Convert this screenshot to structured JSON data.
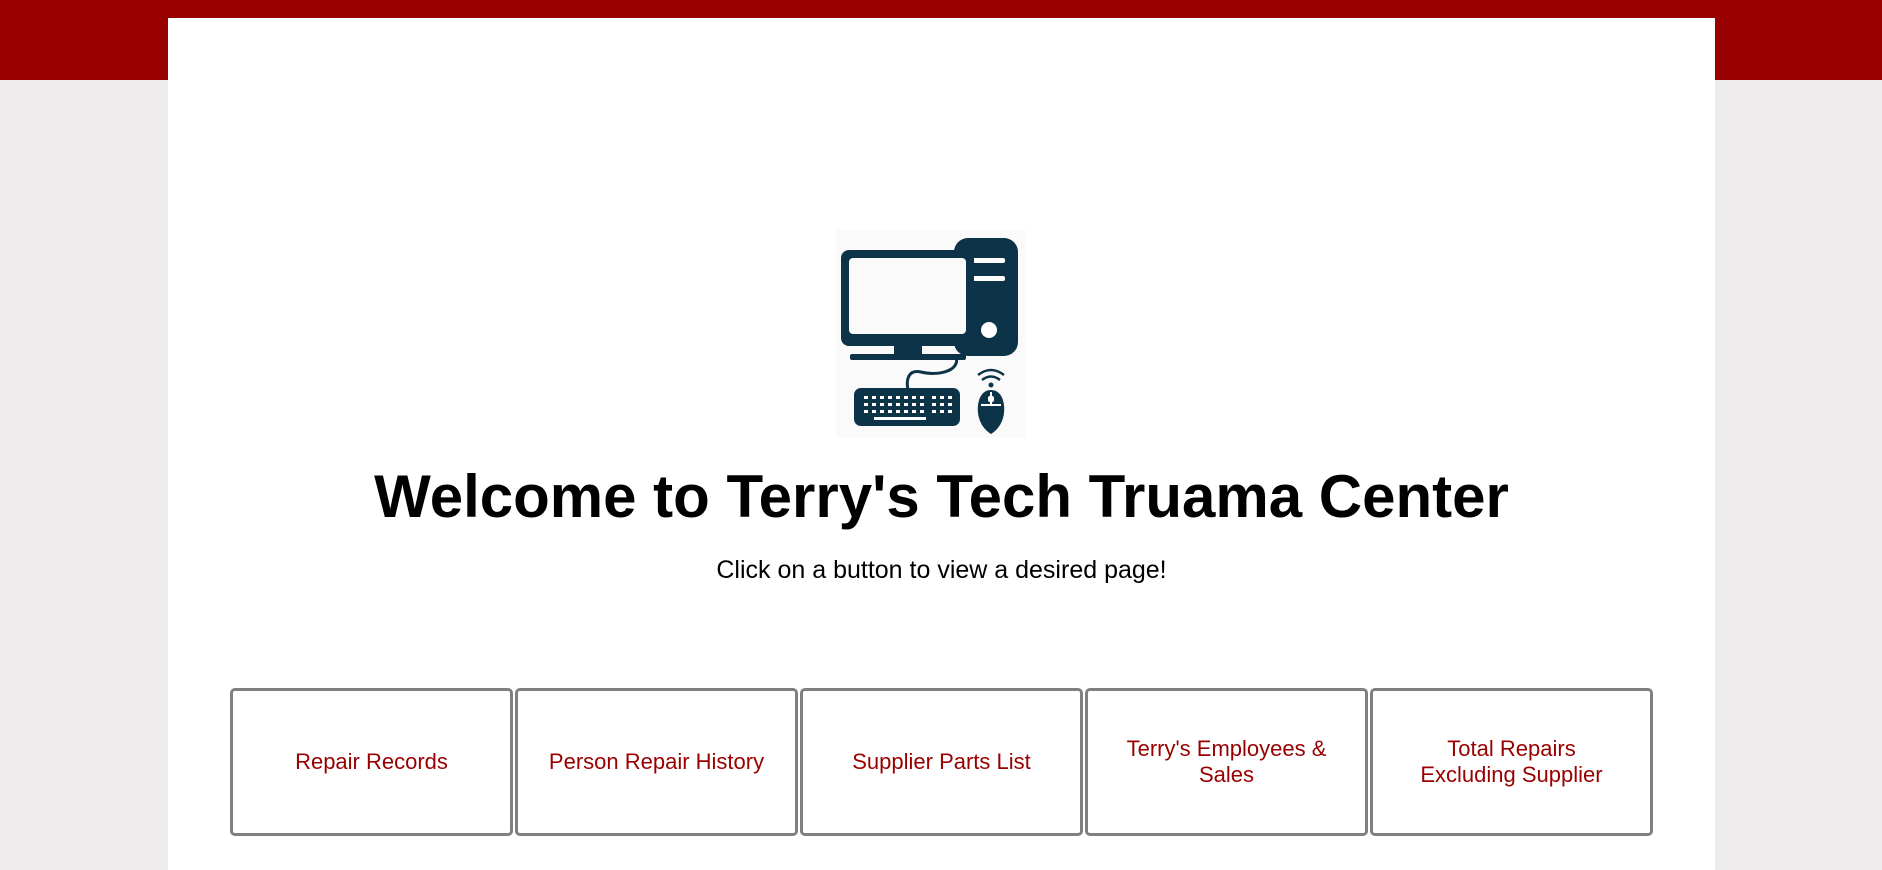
{
  "header": {
    "title": "Welcome to Terry's Tech Truama Center",
    "subtitle": "Click on a button to view a desired page!",
    "logo_icon": "computer-icon"
  },
  "nav": {
    "buttons": [
      {
        "label": "Repair Records"
      },
      {
        "label": "Person Repair History"
      },
      {
        "label": "Supplier Parts List"
      },
      {
        "label": "Terry's Employees & Sales"
      },
      {
        "label": "Total Repairs Excluding Supplier"
      }
    ]
  },
  "colors": {
    "brand": "#990000",
    "background": "#edebeb",
    "icon": "#0d3349",
    "button_border": "#808080"
  }
}
